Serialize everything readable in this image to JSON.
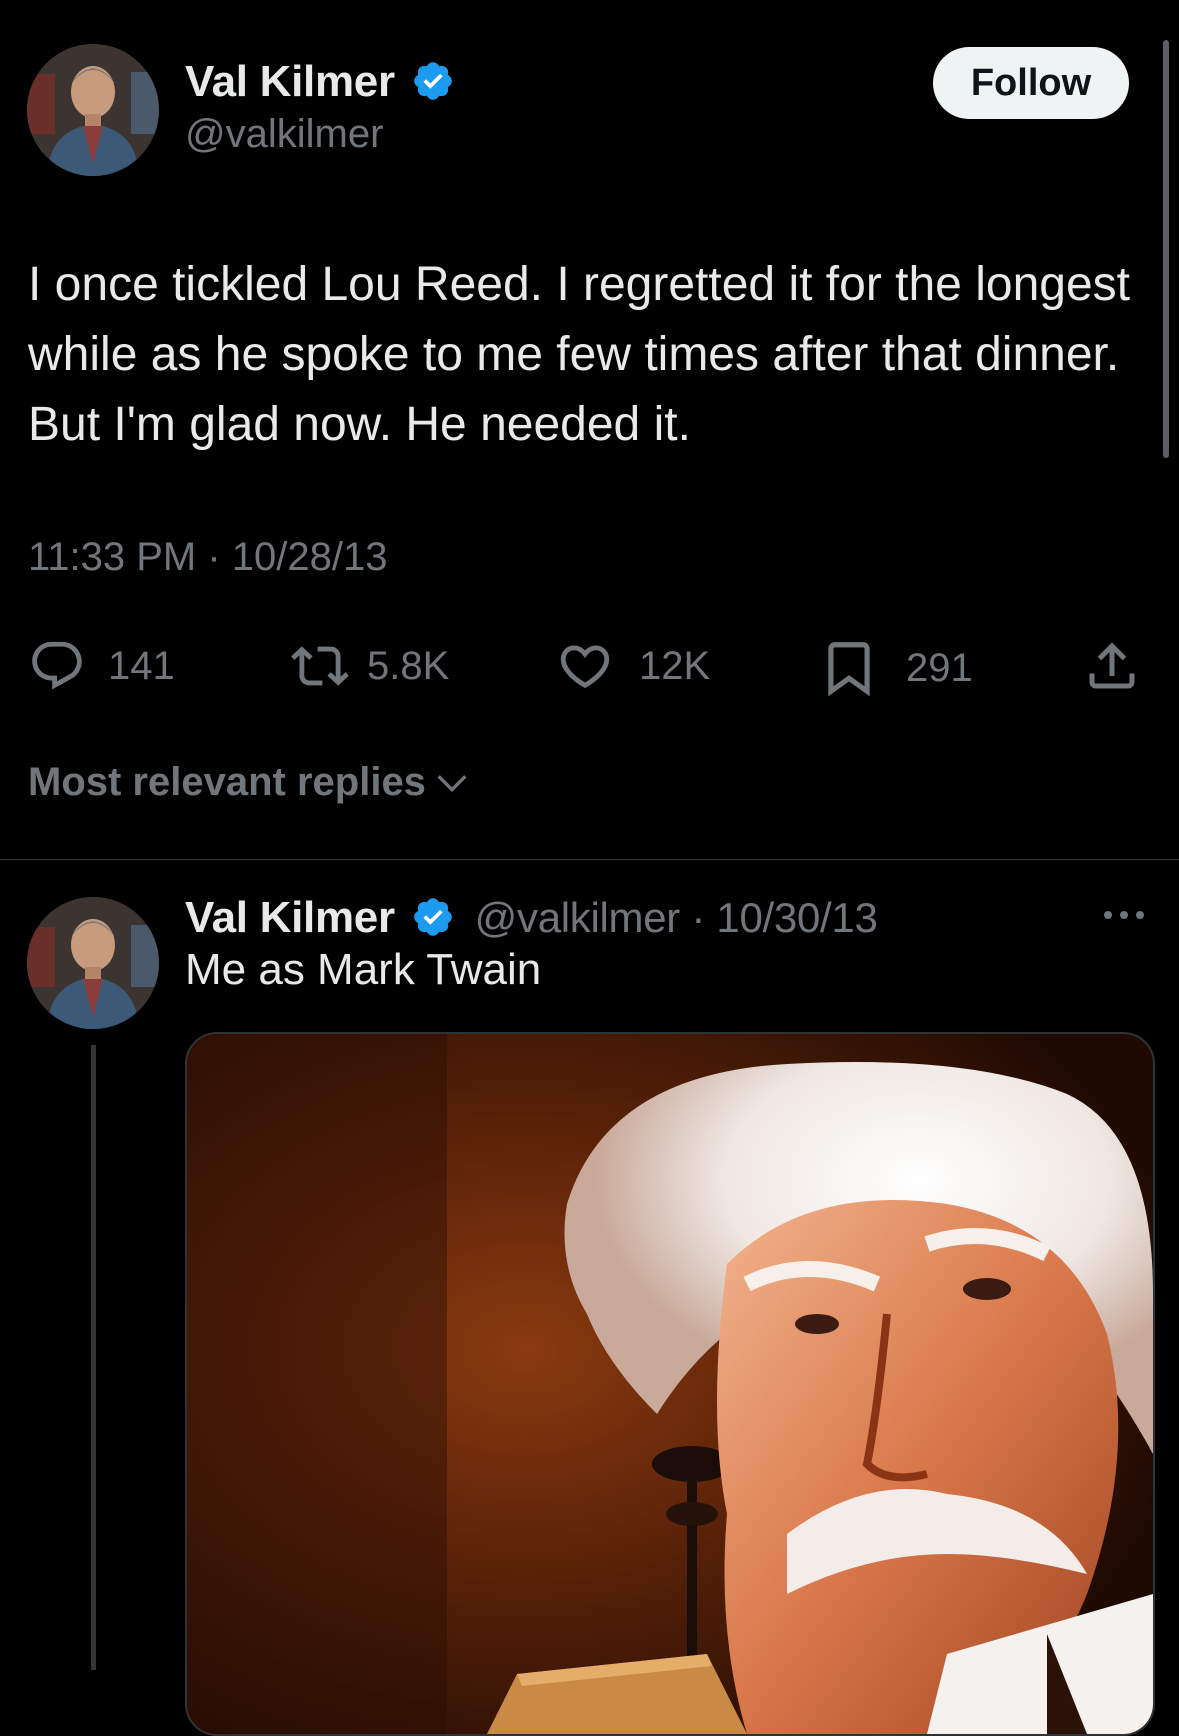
{
  "tweet": {
    "author_name": "Val Kilmer",
    "author_handle": "@valkilmer",
    "follow_label": "Follow",
    "text": "I once tickled Lou Reed. I regretted it for the longest while as he spoke to me few times after that dinner. But I'm glad now. He needed it.",
    "timestamp": "11:33 PM · 10/28/13",
    "stats": {
      "replies": "141",
      "reposts": "5.8K",
      "likes": "12K",
      "bookmarks": "291"
    }
  },
  "sort": {
    "label": "Most relevant replies"
  },
  "reply": {
    "author_name": "Val Kilmer",
    "meta": "@valkilmer · 10/30/13",
    "text": "Me as Mark Twain"
  },
  "colors": {
    "background": "#000000",
    "text": "#e7e9ea",
    "secondary": "#71767b",
    "verified": "#1d9bf0",
    "divider": "#2f3336"
  },
  "icons": [
    "verified-badge-icon",
    "reply-icon",
    "repost-icon",
    "like-icon",
    "bookmark-icon",
    "share-icon",
    "chevron-down-icon",
    "more-icon"
  ]
}
